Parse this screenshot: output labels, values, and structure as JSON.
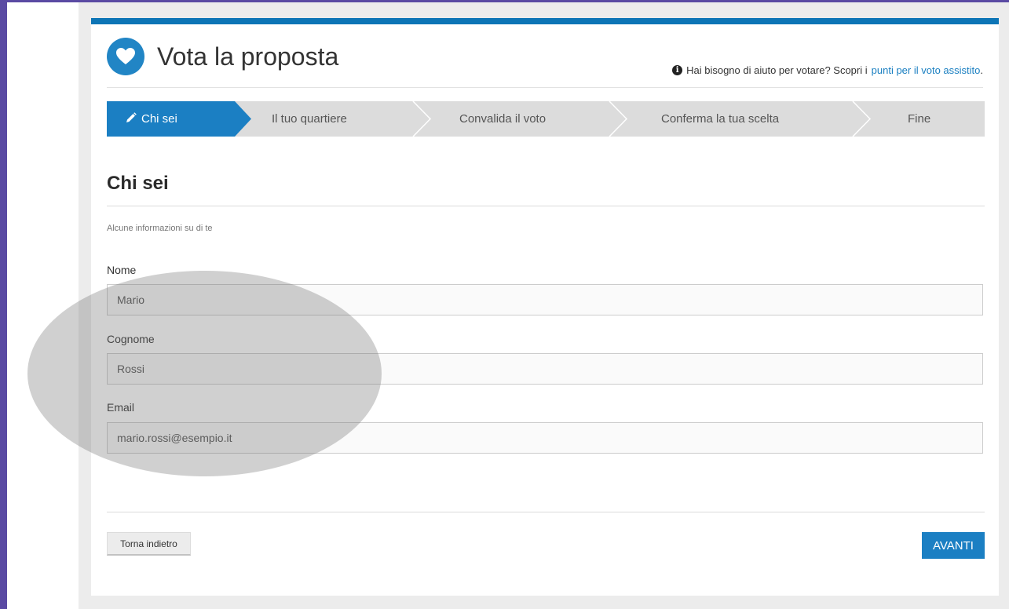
{
  "header": {
    "title": "Vota la proposta",
    "help_prefix": "Hai bisogno di aiuto per votare? Scopri i",
    "help_link": "punti per il voto assistito",
    "help_suffix": "."
  },
  "steps": [
    {
      "label": "Chi sei",
      "active": true
    },
    {
      "label": "Il tuo quartiere",
      "active": false
    },
    {
      "label": "Convalida il voto",
      "active": false
    },
    {
      "label": "Conferma la tua scelta",
      "active": false
    },
    {
      "label": "Fine",
      "active": false
    }
  ],
  "section": {
    "title": "Chi sei",
    "subtitle": "Alcune informazioni su di te"
  },
  "form": {
    "nome_label": "Nome",
    "nome_value": "Mario",
    "cognome_label": "Cognome",
    "cognome_value": "Rossi",
    "email_label": "Email",
    "email_value": "mario.rossi@esempio.it"
  },
  "buttons": {
    "back": "Torna indietro",
    "next": "AVANTI"
  },
  "colors": {
    "accent": "#1b7fc3",
    "step_inactive": "#dcdcdc",
    "frame": "#5a4aa3"
  }
}
